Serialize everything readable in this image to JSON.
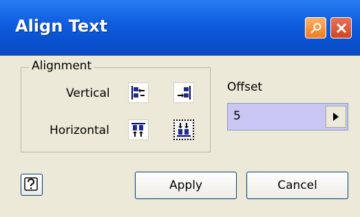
{
  "window": {
    "title": "Align Text",
    "buttons": [
      {
        "icon": "pin-icon",
        "color": "#f07a1f"
      },
      {
        "icon": "close-icon",
        "color": "#d14422"
      }
    ],
    "title_color": "#0a53d2"
  },
  "alignment": {
    "group_label": "Alignment",
    "vertical_label": "Vertical",
    "horizontal_label": "Horizontal",
    "vertical_icons": [
      "align-left-icon",
      "align-right-icon"
    ],
    "horizontal_icons": [
      "align-top-icon",
      "align-bottom-icon"
    ],
    "selected": "align-bottom-icon"
  },
  "offset": {
    "label": "Offset",
    "value": "5",
    "field_color": "#c9c6f4"
  },
  "footer": {
    "help_icon": "help-icon",
    "apply_label": "Apply",
    "cancel_label": "Cancel"
  }
}
